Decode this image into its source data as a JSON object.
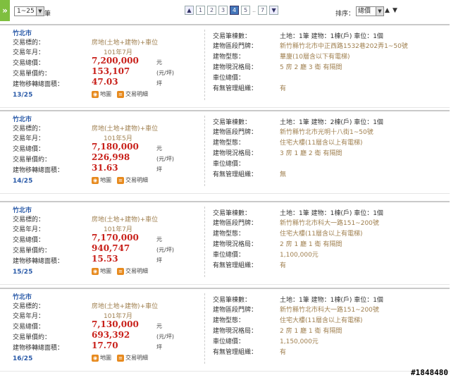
{
  "toolbar": {
    "side_tab": "»",
    "page_size": "1~25",
    "page_size_unit": "筆",
    "pages": [
      "1",
      "2",
      "3",
      "4",
      "5"
    ],
    "current_page": "4",
    "dots": "..",
    "last_page": "7",
    "sort_label": "排序：",
    "sort_value": "總價"
  },
  "records": [
    {
      "city": "竹北市",
      "labels": {
        "type": "交易標的：",
        "date": "交易年月：",
        "total": "交易總價：",
        "unit_price": "交易單價約：",
        "area": "建物移轉總面積："
      },
      "type": "房地(土地+建物)+車位",
      "date": "101年7月",
      "total": "7,200,000",
      "total_unit": "元",
      "unit_price": "153,107",
      "unit_price_unit": "(元/坪)",
      "area": "47.03",
      "area_unit": "坪",
      "index": "13/25",
      "map_btn": "地圖",
      "detail_btn": "交易明細",
      "right_labels": {
        "count": "交易筆棟數：",
        "addr": "建物區段門牌：",
        "kind": "建物型態：",
        "layout": "建物現況格局：",
        "parking": "車位總價：",
        "mgmt": "有無管理組織："
      },
      "count": "土地：1筆 建物：1棟(戶) 車位：1個",
      "addr": "新竹縣竹北市中正西路1532巷202弄1~50號",
      "kind": "華廈(10層含以下有電梯)",
      "layout": "5 房 2 廳 3 衛 有隔間",
      "parking": "",
      "mgmt": "有"
    },
    {
      "city": "竹北市",
      "labels": {
        "type": "交易標的：",
        "date": "交易年月：",
        "total": "交易總價：",
        "unit_price": "交易單價約：",
        "area": "建物移轉總面積："
      },
      "type": "房地(土地+建物)+車位",
      "date": "101年5月",
      "total": "7,180,000",
      "total_unit": "元",
      "unit_price": "226,998",
      "unit_price_unit": "(元/坪)",
      "area": "31.63",
      "area_unit": "坪",
      "index": "14/25",
      "map_btn": "地圖",
      "detail_btn": "交易明細",
      "right_labels": {
        "count": "交易筆棟數：",
        "addr": "建物區段門牌：",
        "kind": "建物型態：",
        "layout": "建物現況格局：",
        "parking": "車位總價：",
        "mgmt": "有無管理組織："
      },
      "count": "土地：1筆 建物：2棟(戶) 車位：1個",
      "addr": "新竹縣竹北市光明十八街1~50號",
      "kind": "住宅大樓(11層含以上有電梯)",
      "layout": "3 房 1 廳 2 衛 有隔間",
      "parking": "",
      "mgmt": "無"
    },
    {
      "city": "竹北市",
      "labels": {
        "type": "交易標的：",
        "date": "交易年月：",
        "total": "交易總價：",
        "unit_price": "交易單價約：",
        "area": "建物移轉總面積："
      },
      "type": "房地(土地+建物)+車位",
      "date": "101年7月",
      "total": "7,170,000",
      "total_unit": "元",
      "unit_price": "940,747",
      "unit_price_unit": "(元/坪)",
      "area": "15.53",
      "area_unit": "坪",
      "index": "15/25",
      "map_btn": "地圖",
      "detail_btn": "交易明細",
      "right_labels": {
        "count": "交易筆棟數：",
        "addr": "建物區段門牌：",
        "kind": "建物型態：",
        "layout": "建物現況格局：",
        "parking": "車位總價：",
        "mgmt": "有無管理組織："
      },
      "count": "土地：1筆 建物：1棟(戶) 車位：1個",
      "addr": "新竹縣竹北市科大一路151~200號",
      "kind": "住宅大樓(11層含以上有電梯)",
      "layout": "2 房 1 廳 1 衛 有隔間",
      "parking": "1,100,000元",
      "mgmt": "有"
    },
    {
      "city": "竹北市",
      "labels": {
        "type": "交易標的：",
        "date": "交易年月：",
        "total": "交易總價：",
        "unit_price": "交易單價約：",
        "area": "建物移轉總面積："
      },
      "type": "房地(土地+建物)+車位",
      "date": "101年7月",
      "total": "7,130,000",
      "total_unit": "元",
      "unit_price": "693,392",
      "unit_price_unit": "(元/坪)",
      "area": "17.70",
      "area_unit": "坪",
      "index": "16/25",
      "map_btn": "地圖",
      "detail_btn": "交易明細",
      "right_labels": {
        "count": "交易筆棟數：",
        "addr": "建物區段門牌：",
        "kind": "建物型態：",
        "layout": "建物現況格局：",
        "parking": "車位總價：",
        "mgmt": "有無管理組織："
      },
      "count": "土地：1筆 建物：1棟(戶) 車位：1個",
      "addr": "新竹縣竹北市科大一路151~200號",
      "kind": "住宅大樓(11層含以上有電梯)",
      "layout": "2 房 1 廳 1 衛 有隔間",
      "parking": "1,150,000元",
      "mgmt": "有"
    }
  ],
  "watermark": "#1848480"
}
